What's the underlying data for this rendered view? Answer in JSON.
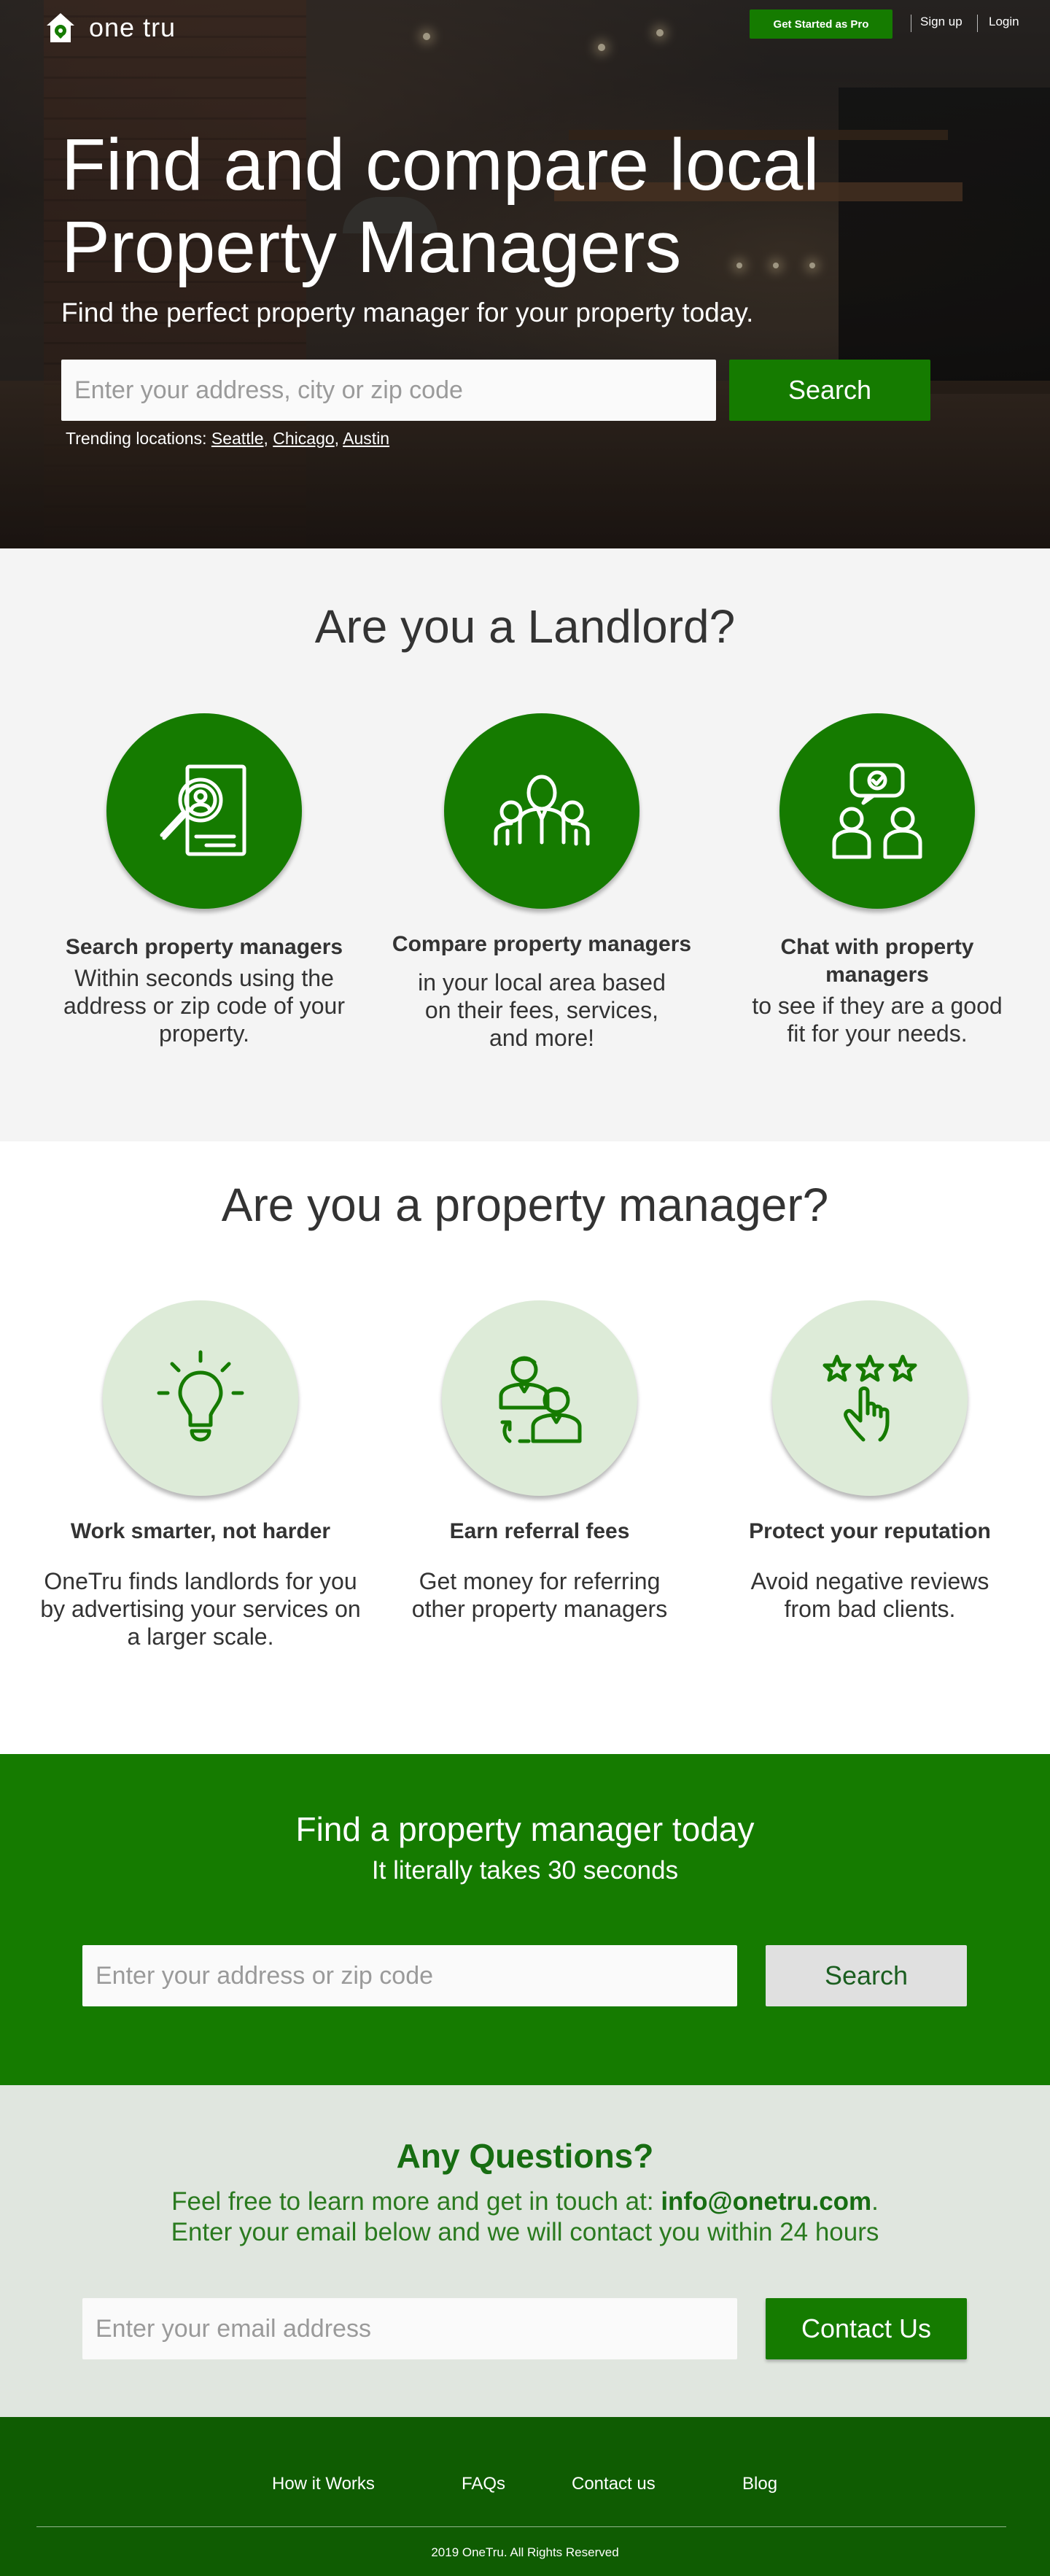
{
  "brand": {
    "name": "one tru"
  },
  "nav": {
    "pro_button": "Get Started as Pro",
    "signup": "Sign up",
    "login": "Login"
  },
  "hero": {
    "title_line1": "Find and compare local",
    "title_line2": "Property Managers",
    "subtitle": "Find the perfect property manager for your property today.",
    "search_placeholder": "Enter your address, city or zip code",
    "search_button": "Search",
    "trending_label": "Trending locations:",
    "trending": [
      "Seattle",
      "Chicago",
      "Austin"
    ]
  },
  "landlord": {
    "title": "Are you a Landlord?",
    "cards": [
      {
        "icon": "search-document-icon",
        "title": "Search property managers",
        "text_lines": [
          "Within seconds using the",
          "address or zip code of your",
          "property."
        ]
      },
      {
        "icon": "group-people-icon",
        "title": "Compare property managers",
        "text_lines": [
          "in your local area based",
          "on their fees, services,",
          "and more!"
        ]
      },
      {
        "icon": "chat-people-icon",
        "title_lines": [
          "Chat with property",
          "managers"
        ],
        "text_lines": [
          "to see if they are a good",
          "fit for your needs."
        ]
      }
    ]
  },
  "pm": {
    "title": "Are you a property manager?",
    "cards": [
      {
        "icon": "lightbulb-icon",
        "title": "Work smarter, not harder",
        "text_lines": [
          "OneTru finds landlords for you",
          "by advertising your services on",
          "a larger scale."
        ]
      },
      {
        "icon": "referral-people-icon",
        "title": "Earn referral fees",
        "text_lines": [
          "Get money for referring",
          "other property managers"
        ]
      },
      {
        "icon": "stars-hand-icon",
        "title": "Protect your reputation",
        "text_lines": [
          "Avoid negative reviews",
          "from bad clients."
        ]
      }
    ]
  },
  "cta": {
    "title": "Find a property manager today",
    "tagline": "It literally takes 30 seconds",
    "placeholder": "Enter your address or zip code",
    "button": "Search"
  },
  "questions": {
    "title": "Any Questions?",
    "line1_prefix": "Feel free to learn more and get in touch at:",
    "email": "info@onetru.com",
    "line1_suffix": ".",
    "line2": "Enter your email below and we will contact you within 24 hours",
    "placeholder": "Enter your email address",
    "button": "Contact Us"
  },
  "footer": {
    "links": [
      "How it Works",
      "FAQs",
      "Contact us",
      "Blog"
    ],
    "copyright": "2019 OneTru. All Rights Reserved"
  },
  "colors": {
    "brand_green": "#157b00",
    "footer_green": "#0f5c02",
    "light_green": "#ddebd8",
    "questions_bg": "#e0e6df"
  }
}
